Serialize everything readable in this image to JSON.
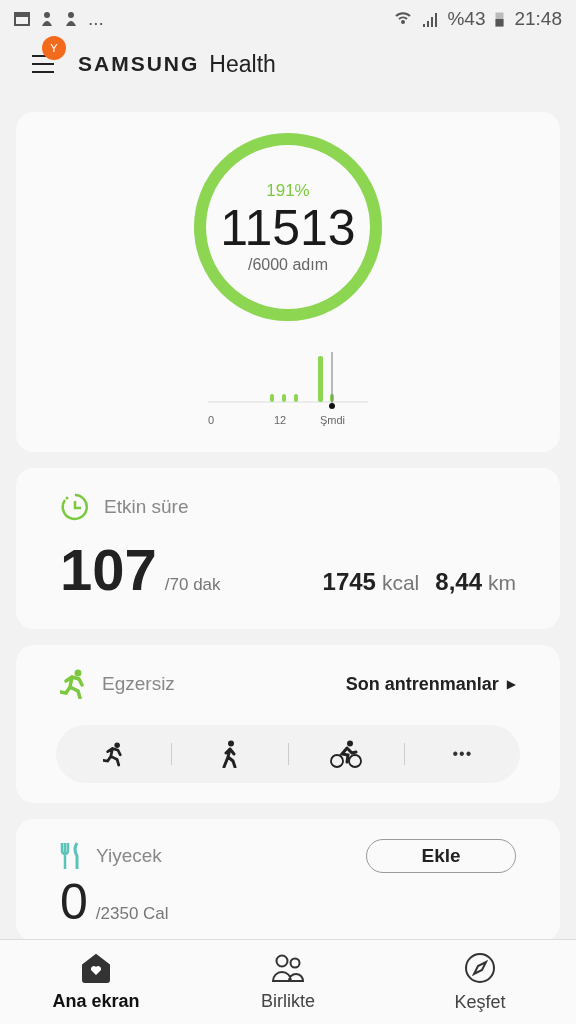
{
  "status_bar": {
    "more": "...",
    "battery": "%43",
    "time": "21:48"
  },
  "header": {
    "badge": "Y",
    "brand": "SAMSUNG",
    "title": "Health"
  },
  "steps": {
    "percent": "191%",
    "count": "11513",
    "goal": "/6000 adım",
    "level": 1,
    "axis_labels": [
      "0",
      "12",
      "Şmdi"
    ]
  },
  "active_time": {
    "title": "Etkin süre",
    "value": "107",
    "goal": "/70 dak",
    "calories": "1745",
    "calories_unit": "kcal",
    "distance": "8,44",
    "distance_unit": "km"
  },
  "exercise": {
    "title": "Egzersiz",
    "link": "Son antrenmanlar",
    "link_arrow": "▶",
    "more": "•••"
  },
  "food": {
    "title": "Yiyecek",
    "button": "Ekle",
    "value": "0",
    "goal": "/2350 Cal"
  },
  "nav": [
    {
      "label": "Ana ekran",
      "kind": "home",
      "selected": true
    },
    {
      "label": "Birlikte",
      "kind": "together",
      "selected": false
    },
    {
      "label": "Keşfet",
      "kind": "discover",
      "selected": false
    }
  ]
}
